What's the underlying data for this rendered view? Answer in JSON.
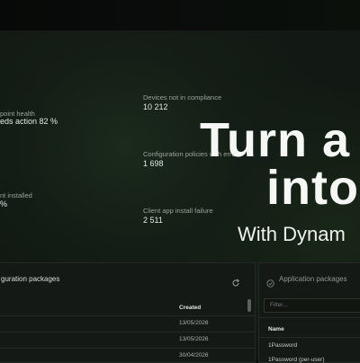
{
  "kpis": {
    "endpoint_health_label": "point health",
    "endpoint_health_value": "eds action 82 %",
    "not_compliance_label": "Devices not in compliance",
    "not_compliance_value": "10 212",
    "config_errors_label": "Configuration policies with errors",
    "config_errors_value": "1 698",
    "client_installed_label": "nt installed",
    "client_installed_value": "%",
    "app_install_failure_label": "Client app install failure",
    "app_install_failure_value": "2 511"
  },
  "config_panel": {
    "title": "guration packages",
    "created_header": "Created",
    "dates": [
      "13/05/2026",
      "13/05/2026",
      "30/04/2026"
    ]
  },
  "app_panel": {
    "title": "Application packages",
    "filter_placeholder": "Filter...",
    "name_header": "Name",
    "rows": [
      "1Password",
      "1Password (per-user)"
    ]
  },
  "hero": {
    "line1": "Turn a",
    "line2": "into",
    "line3": "With Dynam"
  },
  "colors": {
    "background": "#0b0f0c",
    "panel": "#141915",
    "hero_text": "#f4f7f4"
  },
  "icons": {
    "refresh": "refresh-icon",
    "app_packages": "package-icon"
  }
}
